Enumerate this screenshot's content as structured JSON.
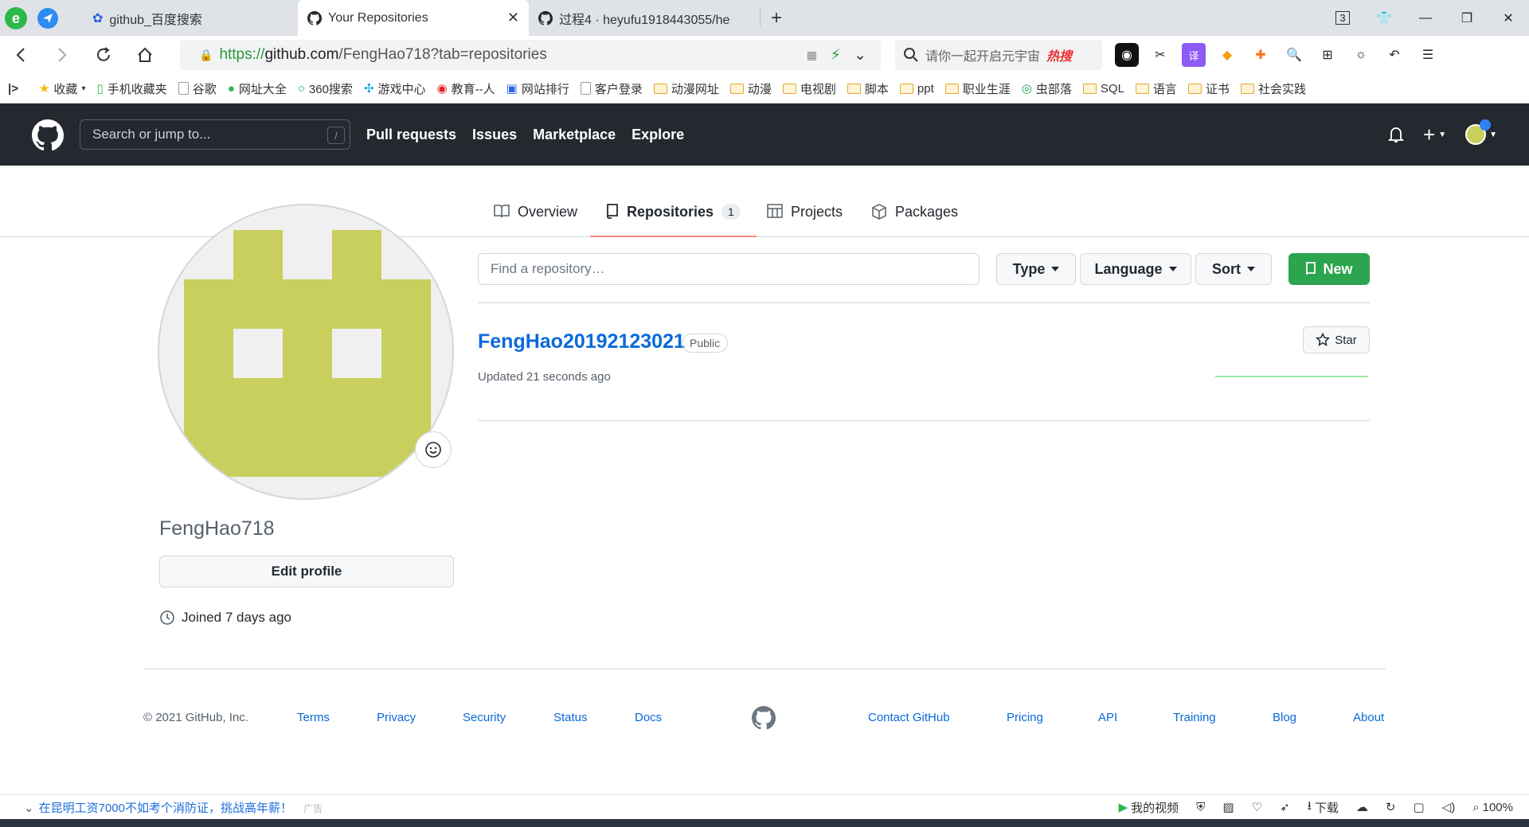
{
  "browser": {
    "tabs": [
      {
        "title": "github_百度搜索",
        "active": false
      },
      {
        "title": "Your Repositories",
        "active": true
      },
      {
        "title": "过程4 · heyufu1918443055/he",
        "active": false
      }
    ],
    "tab_counter": "3",
    "url": {
      "scheme": "https://",
      "host": "github.com",
      "path": "/FengHao718?tab=repositories"
    },
    "search_placeholder": "请你一起开启元宇宙",
    "search_hot": "热搜",
    "bookmarks": [
      {
        "label": "收藏",
        "type": "star"
      },
      {
        "label": "手机收藏夹",
        "type": "phone"
      },
      {
        "label": "谷歌",
        "type": "page"
      },
      {
        "label": "网址大全",
        "type": "site"
      },
      {
        "label": "360搜索",
        "type": "site"
      },
      {
        "label": "游戏中心",
        "type": "site"
      },
      {
        "label": "教育--人",
        "type": "site"
      },
      {
        "label": "网站排行",
        "type": "site"
      },
      {
        "label": "客户登录",
        "type": "page"
      },
      {
        "label": "动漫网址",
        "type": "folder"
      },
      {
        "label": "动漫",
        "type": "folder"
      },
      {
        "label": "电视剧",
        "type": "folder"
      },
      {
        "label": "脚本",
        "type": "folder"
      },
      {
        "label": "ppt",
        "type": "folder"
      },
      {
        "label": "职业生涯",
        "type": "folder"
      },
      {
        "label": "虫部落",
        "type": "site"
      },
      {
        "label": "SQL",
        "type": "folder"
      },
      {
        "label": "语言",
        "type": "folder"
      },
      {
        "label": "证书",
        "type": "folder"
      },
      {
        "label": "社会实践",
        "type": "folder"
      }
    ]
  },
  "github": {
    "search_placeholder": "Search or jump to...",
    "search_shortcut": "/",
    "nav": [
      "Pull requests",
      "Issues",
      "Marketplace",
      "Explore"
    ],
    "profile_tabs": [
      {
        "label": "Overview",
        "icon": "book-icon"
      },
      {
        "label": "Repositories",
        "icon": "repo-icon",
        "count": "1",
        "selected": true
      },
      {
        "label": "Projects",
        "icon": "table-icon"
      },
      {
        "label": "Packages",
        "icon": "package-icon"
      }
    ],
    "username": "FengHao718",
    "edit_profile": "Edit profile",
    "joined": "Joined 7 days ago",
    "find_placeholder": "Find a repository…",
    "filters": {
      "type": "Type",
      "language": "Language",
      "sort": "Sort"
    },
    "new_button": "New",
    "repo": {
      "name": "FengHao20192123021",
      "visibility": "Public",
      "updated": "Updated 21 seconds ago",
      "star": "Star"
    },
    "avatar_color": "#c8cf5c",
    "accent_green": "#2da44e",
    "link_blue": "#0969da"
  },
  "footer": {
    "copyright": "© 2021 GitHub, Inc.",
    "left_links": [
      "Terms",
      "Privacy",
      "Security",
      "Status",
      "Docs"
    ],
    "right_links": [
      "Contact GitHub",
      "Pricing",
      "API",
      "Training",
      "Blog",
      "About"
    ]
  },
  "statusbar": {
    "news": "在昆明工资7000不如考个消防证，挑战高年薪！",
    "ad_tag": "广告",
    "video": "我的视频",
    "download": "下载",
    "zoom": "100%"
  }
}
